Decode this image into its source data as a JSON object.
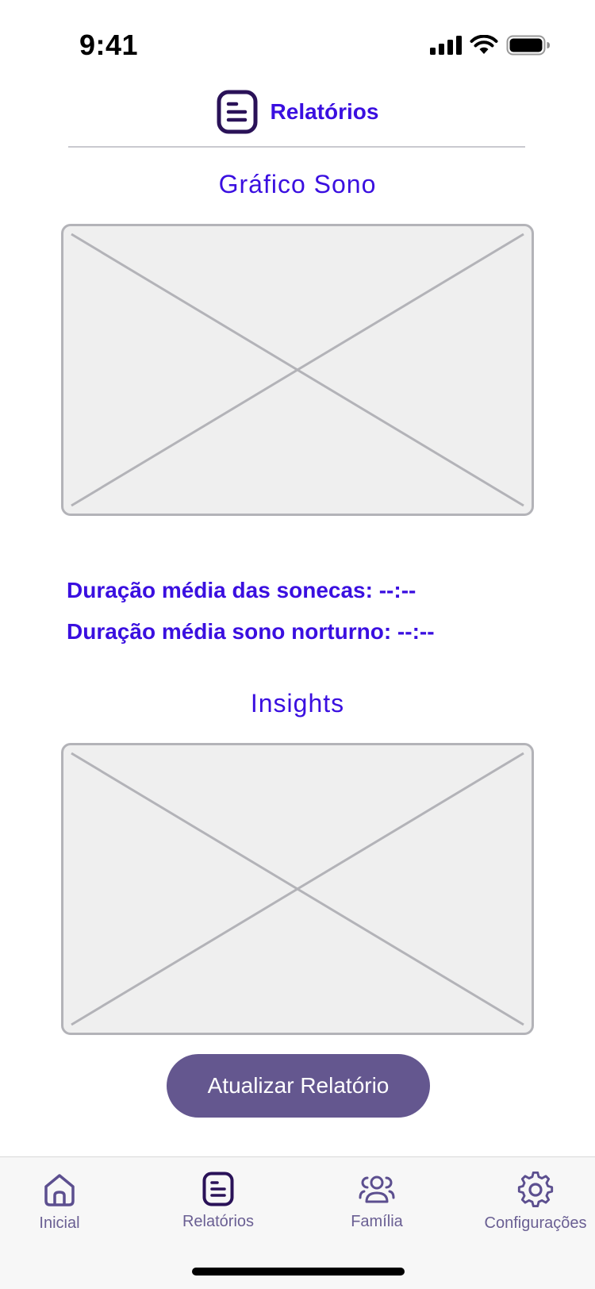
{
  "status_bar": {
    "time": "9:41",
    "icons": [
      "signal-icon",
      "wifi-icon",
      "battery-icon"
    ]
  },
  "header": {
    "icon": "report-icon",
    "title": "Relatórios"
  },
  "sections": {
    "chart_title": "Gráfico Sono",
    "insights_title": "Insights"
  },
  "stats": {
    "naps_avg": "Duração média das sonecas: --:--",
    "night_avg": "Duração média sono norturno: --:--"
  },
  "actions": {
    "update_label": "Atualizar Relatório"
  },
  "tab_bar": {
    "items": [
      {
        "label": "Inicial",
        "icon": "home-icon"
      },
      {
        "label": "Relatórios",
        "icon": "report-icon",
        "active": true
      },
      {
        "label": "Família",
        "icon": "family-icon"
      },
      {
        "label": "Configurações",
        "icon": "gear-icon"
      }
    ]
  },
  "colors": {
    "accent": "#3a0fe0",
    "button": "#64578f",
    "tab_icon": "#5c4f8f",
    "tab_icon_active": "#2a1258",
    "placeholder_fill": "#efefef",
    "placeholder_stroke": "#b3b3b8"
  }
}
